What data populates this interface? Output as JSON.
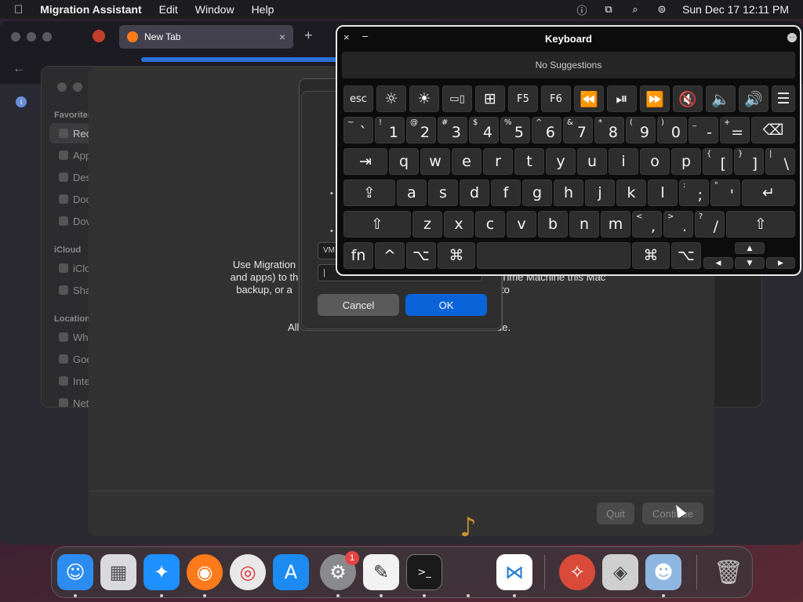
{
  "menubar": {
    "app_name": "Migration Assistant",
    "menus": [
      "Edit",
      "Window",
      "Help"
    ],
    "datetime": "Sun Dec 17  12:11 PM"
  },
  "firefox": {
    "tab_title": "New Tab",
    "tab_close": "×",
    "new_tab": "+",
    "back": "←"
  },
  "finder": {
    "sections": [
      {
        "header": "Favorites",
        "items": [
          "Rec",
          "App",
          "Des",
          "Doc",
          "Dov"
        ]
      },
      {
        "header": "iCloud",
        "items": [
          "iClo",
          "Sha"
        ]
      },
      {
        "header": "Locations",
        "items": [
          "Wh",
          "Goo",
          "Inte",
          "Net"
        ]
      }
    ]
  },
  "migration": {
    "intro_left": "Use Migration and apps) to th backup, or a",
    "intro_right": "Time Machine this Mac to",
    "all_text": "All",
    "all_text_end": "ue.",
    "quit": "Quit",
    "continue": "Continue"
  },
  "sheet": {
    "field_label": "VM",
    "cancel": "Cancel",
    "ok": "OK"
  },
  "keyboard": {
    "title": "Keyboard",
    "close": "×",
    "minimize": "–",
    "more": "···",
    "suggestions": "No Suggestions",
    "rows": {
      "function": [
        "esc",
        "☼",
        "☀",
        "▭▯",
        "⊞",
        "F5",
        "F6",
        "⏪",
        "⏯",
        "⏩",
        "🔇",
        "🔈",
        "🔊",
        "☰"
      ],
      "number": [
        {
          "s": "~",
          "m": "`"
        },
        {
          "s": "!",
          "m": "1"
        },
        {
          "s": "@",
          "m": "2"
        },
        {
          "s": "#",
          "m": "3"
        },
        {
          "s": "$",
          "m": "4"
        },
        {
          "s": "%",
          "m": "5"
        },
        {
          "s": "^",
          "m": "6"
        },
        {
          "s": "&",
          "m": "7"
        },
        {
          "s": "*",
          "m": "8"
        },
        {
          "s": "(",
          "m": "9"
        },
        {
          "s": ")",
          "m": "0"
        },
        {
          "s": "_",
          "m": "-"
        },
        {
          "s": "+",
          "m": "="
        }
      ],
      "qwerty": [
        "q",
        "w",
        "e",
        "r",
        "t",
        "y",
        "u",
        "i",
        "o",
        "p"
      ],
      "qwerty_end": [
        {
          "s": "{",
          "m": "["
        },
        {
          "s": "}",
          "m": "]"
        },
        {
          "s": "|",
          "m": "\\"
        }
      ],
      "asdf": [
        "a",
        "s",
        "d",
        "f",
        "g",
        "h",
        "j",
        "k",
        "l"
      ],
      "asdf_end": [
        {
          "s": ":",
          "m": ";"
        },
        {
          "s": "\"",
          "m": "'"
        }
      ],
      "zxcv": [
        "z",
        "x",
        "c",
        "v",
        "b",
        "n",
        "m"
      ],
      "zxcv_end": [
        {
          "s": "<",
          "m": ","
        },
        {
          "s": ">",
          "m": "."
        },
        {
          "s": "?",
          "m": "/"
        }
      ],
      "bottom": [
        "fn",
        "^",
        "⌥",
        "⌘"
      ],
      "bottom_right": [
        "⌘",
        "⌥"
      ]
    },
    "delete": "⌫",
    "tab": "⇥",
    "caps": "⇪",
    "return": "↵",
    "shift": "⇧",
    "arrows": {
      "up": "▲",
      "down": "▼",
      "left": "◀",
      "right": "▶"
    }
  },
  "dock": {
    "apps": [
      {
        "name": "Finder",
        "glyph": "☺",
        "color": "#2d8cf0"
      },
      {
        "name": "Launchpad",
        "glyph": "▦",
        "color": "#d9d9de"
      },
      {
        "name": "Safari",
        "glyph": "✦",
        "color": "#1e90ff"
      },
      {
        "name": "Firefox",
        "glyph": "◉",
        "color": "#ff7a1a"
      },
      {
        "name": "Chrome",
        "glyph": "◎",
        "color": "#e8e8e8"
      },
      {
        "name": "App Store",
        "glyph": "A",
        "color": "#1c8cf2"
      },
      {
        "name": "System Settings",
        "glyph": "⚙",
        "color": "#8a8a8e"
      },
      {
        "name": "TextEdit",
        "glyph": "✎",
        "color": "#f2f2f2"
      },
      {
        "name": "Terminal",
        "glyph": ">_",
        "color": "#1a1a1a"
      },
      {
        "name": "Migration Assistant",
        "glyph": "♪",
        "color": "#c8922e"
      },
      {
        "name": "VS Code",
        "glyph": "⋈",
        "color": "#ffffff"
      },
      {
        "name": "Instruments",
        "glyph": "✧",
        "color": "#d94a3b"
      },
      {
        "name": "Boot Camp",
        "glyph": "◈",
        "color": "#cfcfcf"
      },
      {
        "name": "Finder Window",
        "glyph": "☻",
        "color": "#8fb6e0"
      },
      {
        "name": "Trash",
        "glyph": "🗑",
        "color": "#bfbfbf"
      }
    ],
    "badge": "1"
  }
}
